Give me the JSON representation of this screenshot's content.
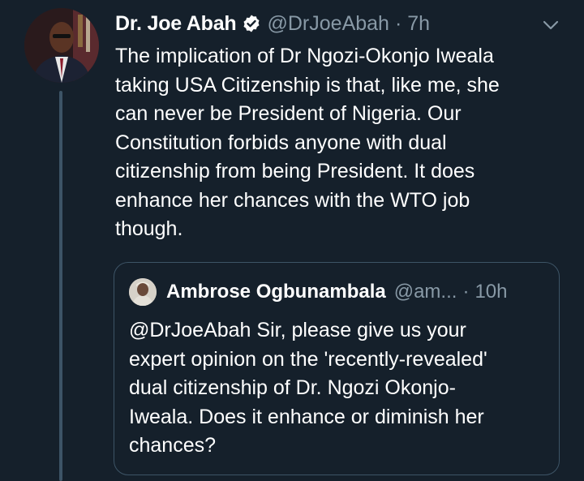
{
  "tweet": {
    "display_name": "Dr. Joe Abah",
    "handle": "@DrJoeAbah",
    "separator": "·",
    "time": "7h",
    "text": "The implication of Dr Ngozi-Okonjo Iweala\ntaking USA Citizenship is that, like me, she\ncan never be President of Nigeria. Our\nConstitution forbids anyone with dual\ncitizenship from being President. It does\nenhance her chances with the WTO job\nthough."
  },
  "quoted_tweet": {
    "display_name": "Ambrose Ogbunambala",
    "handle": "@am...",
    "separator": "·",
    "time": "10h",
    "text": "@DrJoeAbah Sir, please give us your\nexpert opinion on the 'recently-revealed'\ndual citizenship of Dr. Ngozi Okonjo-\nIweala. Does it enhance or diminish her\nchances?"
  },
  "icons": {
    "verified": "verified-badge-icon",
    "menu": "chevron-down-icon"
  },
  "colors": {
    "background": "#15202b",
    "secondary_text": "#8899a6",
    "border": "#3d5466"
  }
}
